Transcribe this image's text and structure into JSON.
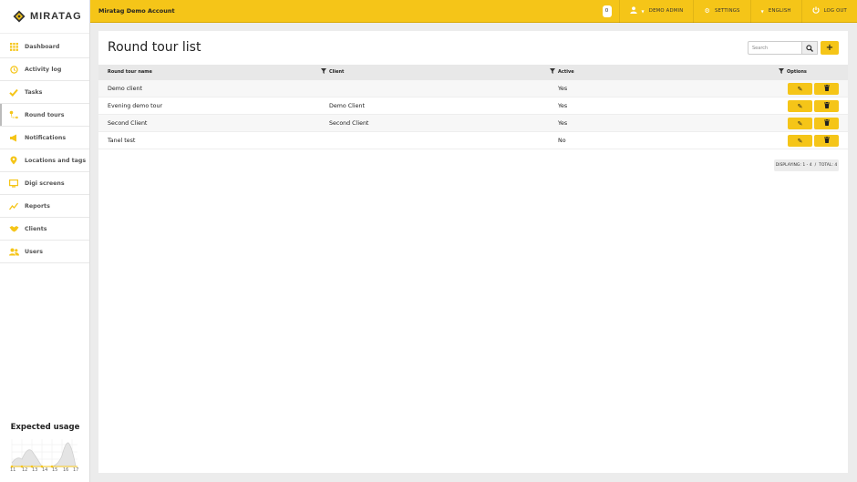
{
  "brand": {
    "logo_text": "MIRATAG"
  },
  "topbar": {
    "account": "Miratag Demo Account",
    "notifications_count": "0",
    "user": "DEMO ADMIN",
    "settings": "SETTINGS",
    "language": "ENGLISH",
    "logout": "LOG OUT"
  },
  "sidebar": {
    "items": [
      {
        "label": "Dashboard",
        "icon": "grid-icon"
      },
      {
        "label": "Activity log",
        "icon": "history-icon"
      },
      {
        "label": "Tasks",
        "icon": "check-icon"
      },
      {
        "label": "Round tours",
        "icon": "route-icon"
      },
      {
        "label": "Notifications",
        "icon": "megaphone-icon"
      },
      {
        "label": "Locations and tags",
        "icon": "pin-icon"
      },
      {
        "label": "Digi screens",
        "icon": "screen-icon"
      },
      {
        "label": "Reports",
        "icon": "chart-icon"
      },
      {
        "label": "Clients",
        "icon": "handshake-icon"
      },
      {
        "label": "Users",
        "icon": "users-icon"
      }
    ],
    "active_index": 3,
    "usage": {
      "title": "Expected usage",
      "x_ticks": [
        "11",
        "12",
        "13",
        "14",
        "15",
        "16",
        "17"
      ]
    }
  },
  "page": {
    "title": "Round tour list",
    "search_placeholder": "Search",
    "columns": [
      "Round tour name",
      "Client",
      "Active",
      "Options"
    ],
    "rows": [
      {
        "name": "Demo client",
        "client": "",
        "active": "Yes"
      },
      {
        "name": "Evening demo tour",
        "client": "Demo Client",
        "active": "Yes"
      },
      {
        "name": "Second Client",
        "client": "Second Client",
        "active": "Yes"
      },
      {
        "name": "Tanel test",
        "client": "",
        "active": "No"
      }
    ],
    "displaying": "DISPLAYING: 1 - 4",
    "separator": "/",
    "total": "TOTAL: 4"
  },
  "colors": {
    "accent": "#f5c518"
  }
}
